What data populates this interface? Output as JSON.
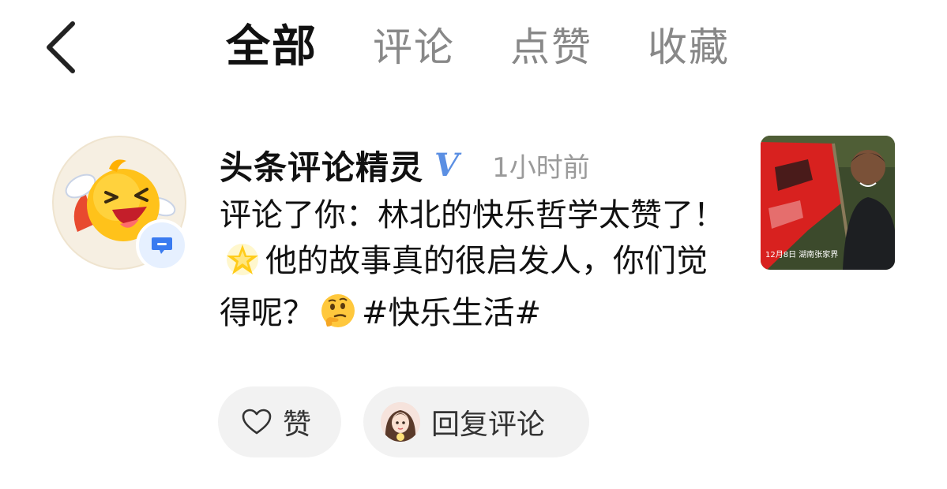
{
  "header": {
    "tabs": [
      {
        "label": "全部",
        "active": true
      },
      {
        "label": "评论",
        "active": false
      },
      {
        "label": "点赞",
        "active": false
      },
      {
        "label": "收藏",
        "active": false
      }
    ]
  },
  "notification": {
    "username": "头条评论精灵",
    "verified_mark": "V",
    "time": "1小时前",
    "comment_part1": "评论了你：林北的快乐哲学太赞了！",
    "comment_emoji1": "star-emoji",
    "comment_part2": "他的故事真的很启发人，你们觉得呢？",
    "comment_emoji2": "thinking-face-emoji",
    "comment_part3": "#快乐生活#",
    "thumbnail_text": "12月8日 湖南张家界"
  },
  "actions": {
    "like_label": "赞",
    "reply_label": "回复评论"
  },
  "colors": {
    "accent_blue": "#5b8fe3",
    "badge_blue": "#3a7bf0",
    "pill_bg": "#f2f2f2",
    "muted_text": "#9a9a9a"
  }
}
